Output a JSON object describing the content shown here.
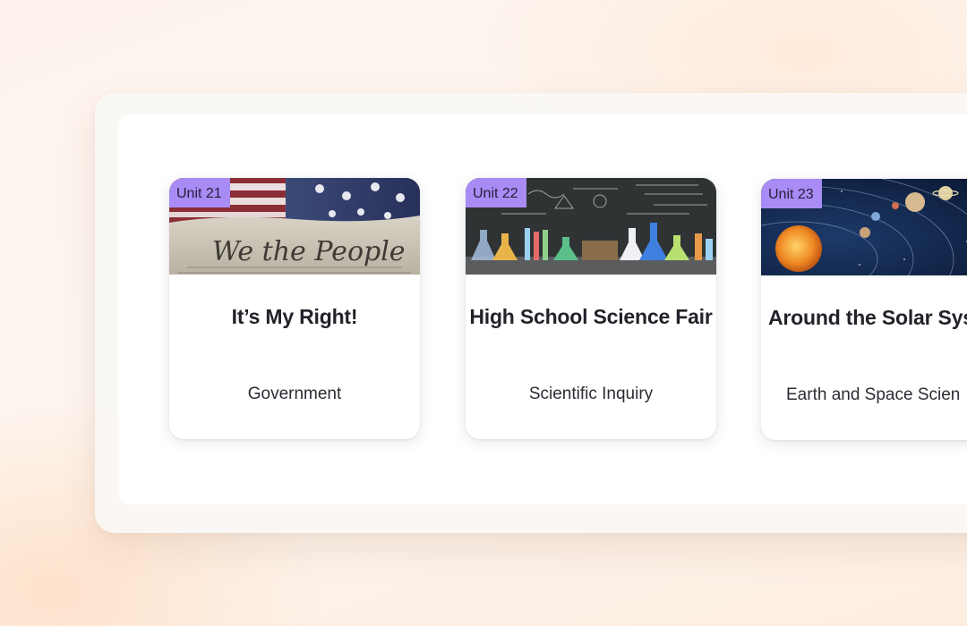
{
  "units": [
    {
      "badge": "Unit 21",
      "title": "It’s My Right!",
      "subject": "Government",
      "image_icon": "we-the-people-constitution-image",
      "image_text": "We the People"
    },
    {
      "badge": "Unit 22",
      "title": "High School Science Fair",
      "subject": "Scientific Inquiry",
      "image_icon": "science-lab-chalkboard-image"
    },
    {
      "badge": "Unit 23",
      "title": "Around the Solar Sys",
      "subject": "Earth and Space Scien",
      "image_icon": "solar-system-image"
    }
  ],
  "colors": {
    "badge_background": "#a98bf5",
    "card_background": "#ffffff",
    "title_text": "#22222a"
  }
}
